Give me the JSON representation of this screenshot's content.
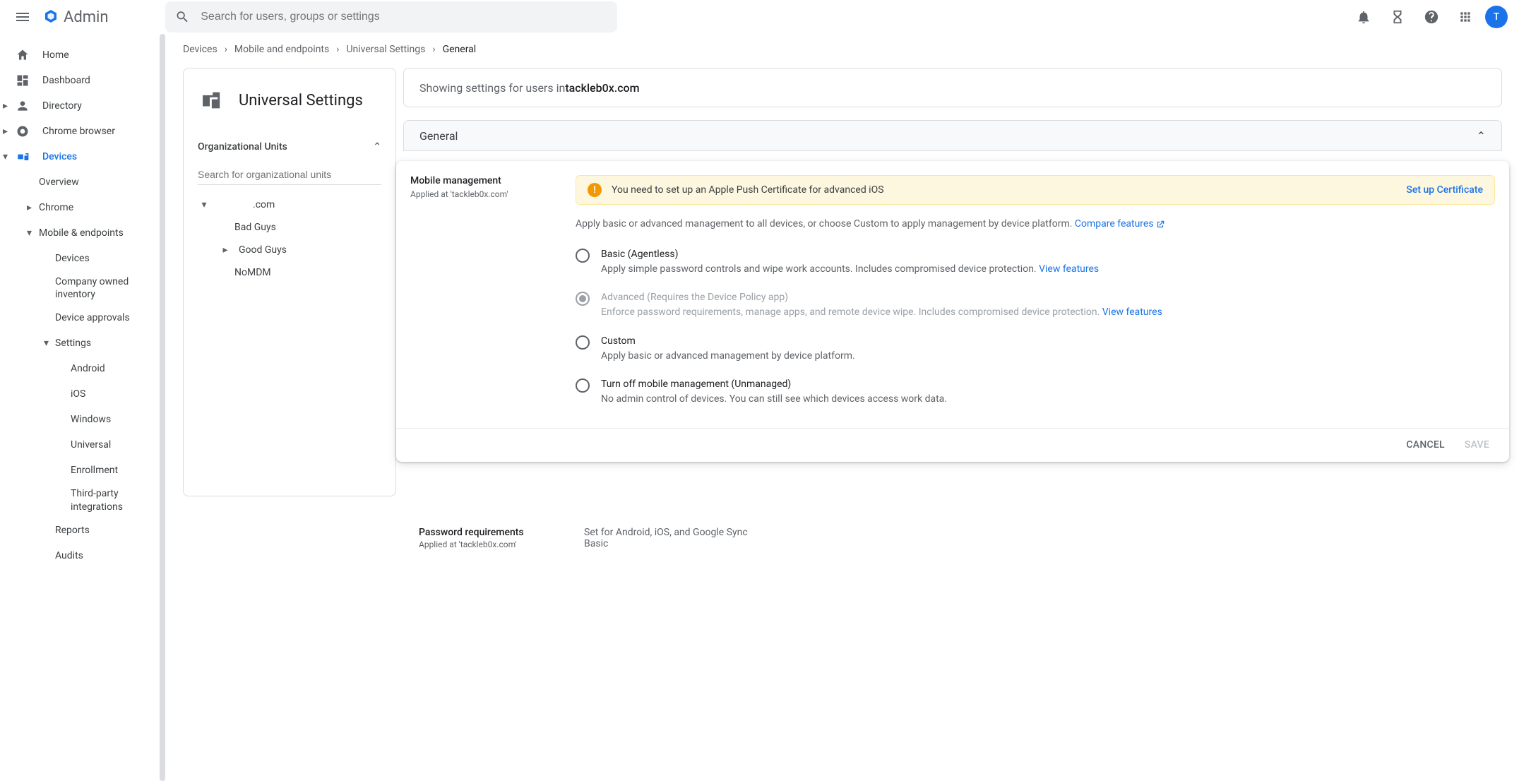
{
  "header": {
    "app_name": "Admin",
    "search_placeholder": "Search for users, groups or settings",
    "avatar_initial": "T"
  },
  "sidenav": {
    "home": "Home",
    "dashboard": "Dashboard",
    "directory": "Directory",
    "chrome_browser": "Chrome browser",
    "devices": "Devices",
    "overview": "Overview",
    "chrome": "Chrome",
    "mobile_endpoints": "Mobile & endpoints",
    "devices_sub": "Devices",
    "company_inventory": "Company owned inventory",
    "device_approvals": "Device approvals",
    "settings": "Settings",
    "android": "Android",
    "ios": "iOS",
    "windows": "Windows",
    "universal": "Universal",
    "enrollment": "Enrollment",
    "third_party": "Third-party integrations",
    "reports": "Reports",
    "audits": "Audits"
  },
  "breadcrumb": {
    "a": "Devices",
    "b": "Mobile and endpoints",
    "c": "Universal Settings",
    "d": "General"
  },
  "left_panel": {
    "title": "Universal Settings",
    "ou_header": "Organizational Units",
    "ou_search_placeholder": "Search for organizational units",
    "ou_root": ".com",
    "ou_child1": "Bad Guys",
    "ou_child2": "Good Guys",
    "ou_child3": "NoMDM"
  },
  "scope": {
    "prefix": "Showing settings for users in ",
    "domain": "tackleb0x.com"
  },
  "section": {
    "title": "General"
  },
  "mobile_mgmt": {
    "title": "Mobile management",
    "applied": "Applied at 'tackleb0x.com'",
    "alert_text": "You need to set up an Apple Push Certificate for advanced iOS",
    "alert_link": "Set up Certificate",
    "intro": "Apply basic or advanced management to all devices, or choose Custom to apply management by device platform. ",
    "compare": "Compare features",
    "options": {
      "basic": {
        "title": "Basic (Agentless)",
        "desc": "Apply simple password controls and wipe work accounts. Includes compromised device protection. ",
        "link": "View features"
      },
      "advanced": {
        "title": "Advanced (Requires the Device Policy app)",
        "desc": "Enforce password requirements, manage apps, and remote device wipe. Includes compromised device protection. ",
        "link": "View features"
      },
      "custom": {
        "title": "Custom",
        "desc": "Apply basic or advanced management by device platform."
      },
      "off": {
        "title": "Turn off mobile management (Unmanaged)",
        "desc": "No admin control of devices. You can still see which devices access work data."
      }
    },
    "cancel": "CANCEL",
    "save": "SAVE"
  },
  "password_req": {
    "title": "Password requirements",
    "applied": "Applied at 'tackleb0x.com'",
    "line1": "Set for Android, iOS, and Google Sync",
    "line2": "Basic"
  }
}
